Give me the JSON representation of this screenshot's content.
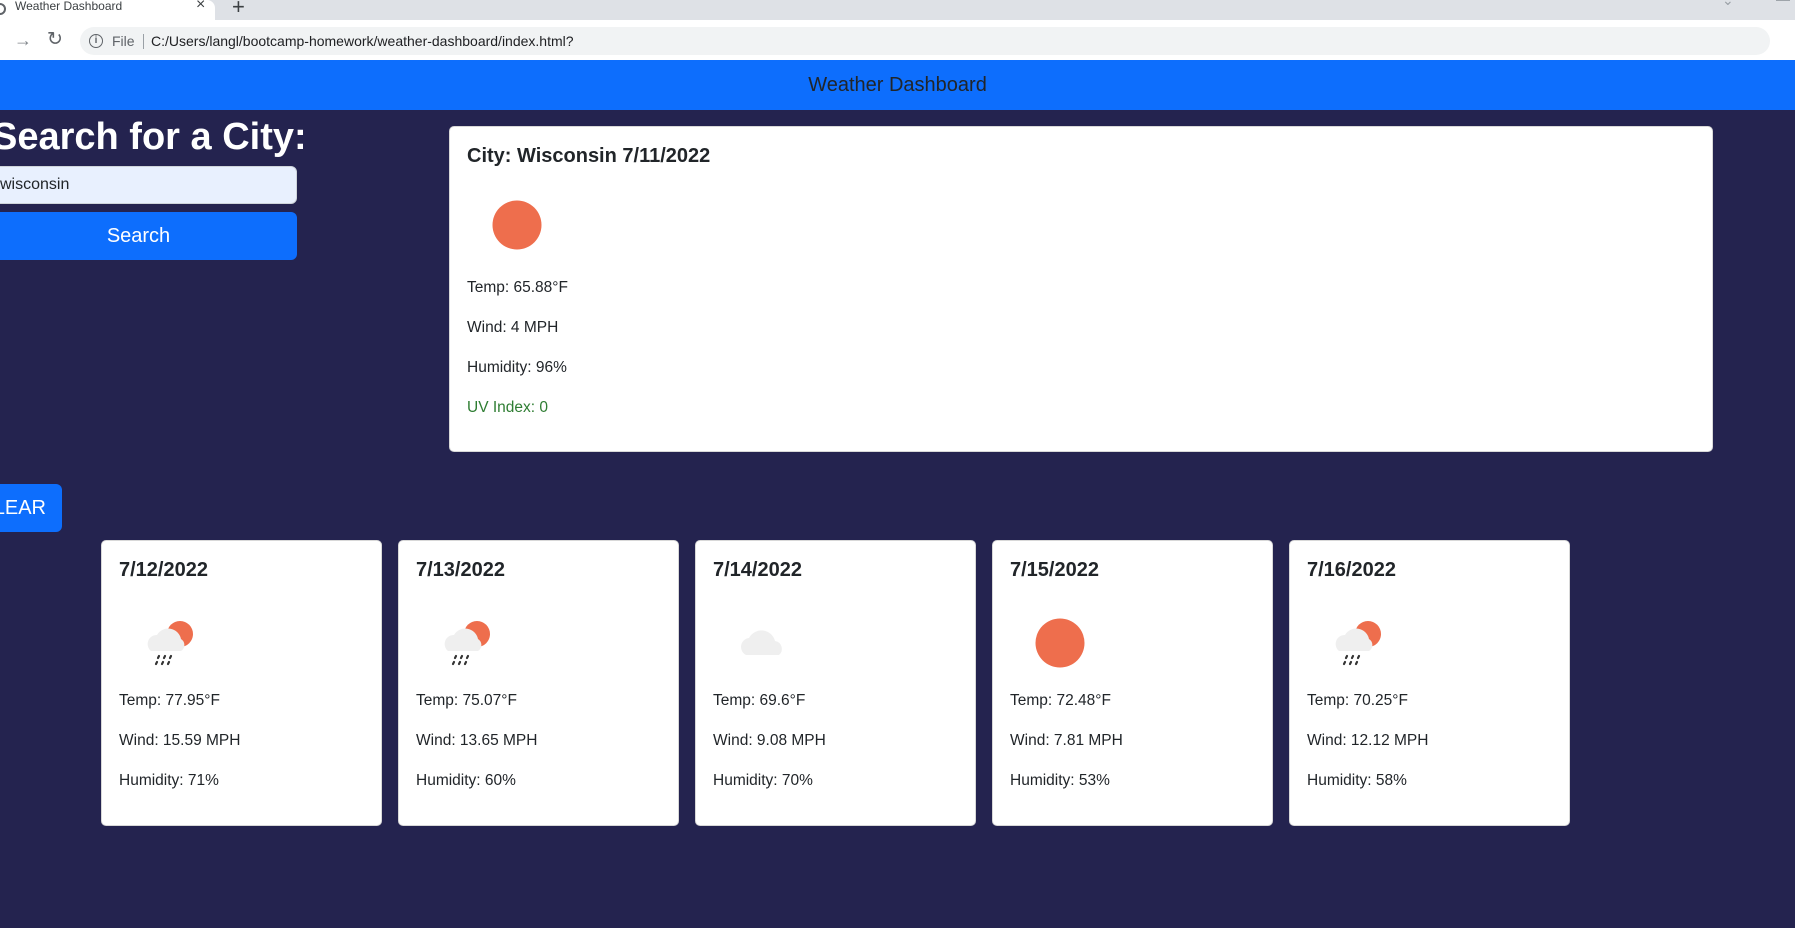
{
  "browser": {
    "tab_title": "Weather Dashboard",
    "new_tab_label": "+",
    "file_label": "File",
    "url": "C:/Users/langl/bootcamp-homework/weather-dashboard/index.html?"
  },
  "header": {
    "title": "Weather Dashboard"
  },
  "search": {
    "heading": "Search for a City:",
    "input_value": "wisconsin",
    "button_label": "Search",
    "clear_label": "CLEAR"
  },
  "current": {
    "title": "City: Wisconsin 7/11/2022",
    "icon": "sun-icon",
    "temp": "Temp: 65.88°F",
    "wind": "Wind: 4 MPH",
    "humidity": "Humidity: 96%",
    "uv": "UV Index: 0",
    "uv_color": "#2e7d32"
  },
  "forecast": [
    {
      "date": "7/12/2022",
      "icon": "rain-sun-icon",
      "temp": "Temp: 77.95°F",
      "wind": "Wind: 15.59 MPH",
      "humidity": "Humidity: 71%"
    },
    {
      "date": "7/13/2022",
      "icon": "rain-sun-icon",
      "temp": "Temp: 75.07°F",
      "wind": "Wind: 13.65 MPH",
      "humidity": "Humidity: 60%"
    },
    {
      "date": "7/14/2022",
      "icon": "cloud-icon",
      "temp": "Temp: 69.6°F",
      "wind": "Wind: 9.08 MPH",
      "humidity": "Humidity: 70%"
    },
    {
      "date": "7/15/2022",
      "icon": "sun-icon",
      "temp": "Temp: 72.48°F",
      "wind": "Wind: 7.81 MPH",
      "humidity": "Humidity: 53%"
    },
    {
      "date": "7/16/2022",
      "icon": "rain-sun-icon",
      "temp": "Temp: 70.25°F",
      "wind": "Wind: 12.12 MPH",
      "humidity": "Humidity: 58%"
    }
  ],
  "colors": {
    "page_background": "#24234f",
    "primary": "#0d6efd",
    "sun": "#ee6e4d"
  }
}
